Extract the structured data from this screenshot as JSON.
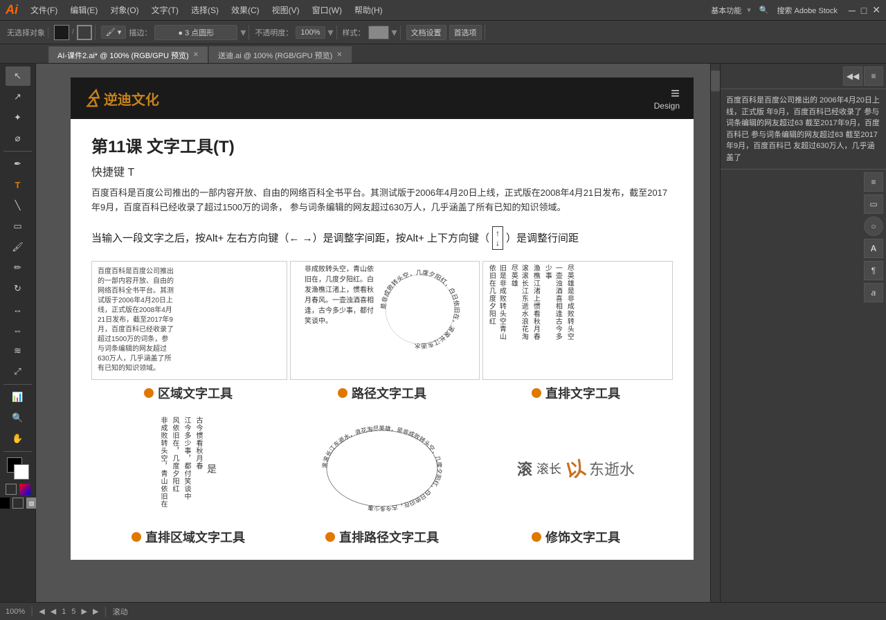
{
  "app": {
    "logo": "Ai",
    "menubar": {
      "items": [
        "文件(F)",
        "编辑(E)",
        "对象(O)",
        "文字(T)",
        "选择(S)",
        "效果(C)",
        "视图(V)",
        "窗口(W)",
        "帮助(H)"
      ]
    },
    "right_controls": {
      "workspace": "基本功能",
      "search_placeholder": "搜索 Adobe Stock"
    }
  },
  "toolbar": {
    "no_selection": "无选择对象",
    "paint_tool": "描边：",
    "point_label": "● 3 点圆形",
    "opacity_label": "不透明度：",
    "opacity_value": "100%",
    "style_label": "样式：",
    "doc_settings": "文档设置",
    "preferences": "首选项"
  },
  "tabs": [
    {
      "label": "AI-课件2.ai* @ 100% (RGB/GPU 预览)",
      "active": true
    },
    {
      "label": "送迪.ai @ 100% (RGB/GPU 预览)",
      "active": false
    }
  ],
  "artboard": {
    "brand_logo": "逆迪文化",
    "design_label": "Design",
    "lesson_title": "第11课   文字工具(T)",
    "shortcut": "快捷键 T",
    "description": "百度百科是百度公司推出的一部内容开放、自由的网络百科全书平台。其测试版于2006年4月20日上线，正式版在2008年4月21日发布，截至2017年9月，百度百科已经收录了超过1500万的词条，\n参与词条编辑的网友超过630万人，几乎涵盖了所有已知的知识领域。",
    "adjust_text": "当输入一段文字之后，按Alt+ 左右方向键（← →）是调整字间距，按Alt+ 上下方向键（",
    "adjust_suffix": "）是调整行间距",
    "tools": [
      {
        "name": "区域文字工具"
      },
      {
        "name": "路径文字工具"
      },
      {
        "name": "直排文字工具"
      }
    ],
    "tools_bottom": [
      {
        "name": "直排区域文字工具"
      },
      {
        "name": "直排路径文字工具"
      },
      {
        "name": "修饰文字工具"
      }
    ],
    "sample_text": "百度百科是百度公司推出的一部内容开放、自由的网络百科全书平台。其测试版于2006年4月20日上线，正式版在2008年4月21日发布，截至2017年9月，百度百科已经收录了超过1500万的词条，参与词条编辑的网友超过630万人，几乎涵盖了所有已知的知识领域。",
    "poem_text": "非成败转头空，青山依旧在，几度夕阳红。白发渔樵江渚上，惯看秋月春风。一壶浊酒喜相逢，古今多少事，都付笑谈中。",
    "poem_circle_text": "是非成败转头空，几度夕阳红，白日依旧在，滚滚长江东逝水",
    "deco_text1": "滚 滚长 以 东逝水",
    "deco_text2": "旧是非成败转头空，青山依旧在，几度夕阳红。白发渔樵江渚上，惯看秋月春风。一壶浊酒喜相逢，古今多少事，都付笑谈中。滚滚长江东逝水"
  },
  "right_panel": {
    "text": "百度百科是百度公司推出的\n2006年4月20日上线，正式版\n年9月，百度百科已经收录了\n参与词条编辑的网友超过63\n截至2017年9月，百度百科已\n参与词条编辑的网友超过63\n截至2017年9月，百度百科已\n友超过630万人，几乎涵盖了"
  },
  "status_bar": {
    "zoom": "100%",
    "page_info": "1",
    "total_pages": "5",
    "position": "滚动"
  }
}
